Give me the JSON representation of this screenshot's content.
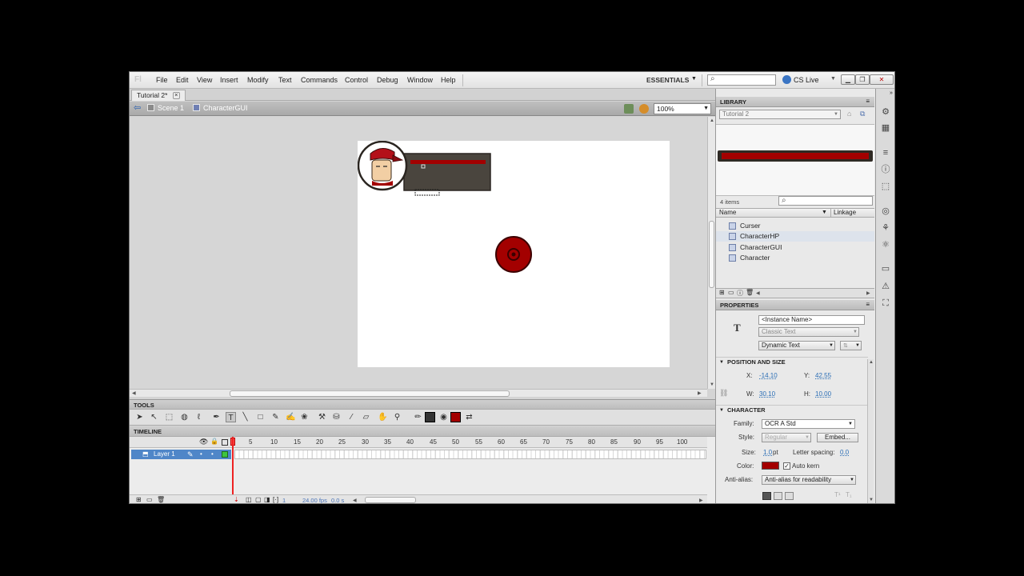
{
  "menu": [
    "File",
    "Edit",
    "View",
    "Insert",
    "Modify",
    "Text",
    "Commands",
    "Control",
    "Debug",
    "Window",
    "Help"
  ],
  "app_logo": "Fl",
  "workspace": "ESSENTIALS",
  "cs_live": "CS Live",
  "doc_tab": "Tutorial 2*",
  "breadcrumbs": [
    "Scene 1",
    "CharacterGUI"
  ],
  "zoom": "100%",
  "panels": {
    "tools": "TOOLS",
    "timeline": "TIMELINE",
    "library": "LIBRARY",
    "properties": "PROPERTIES"
  },
  "timeline": {
    "layer_name": "Layer 1",
    "frame_numbers": [
      "5",
      "10",
      "15",
      "20",
      "25",
      "30",
      "35",
      "40",
      "45",
      "50",
      "55",
      "60",
      "65",
      "70",
      "75",
      "80",
      "85",
      "90",
      "95",
      "100"
    ],
    "current_frame": "1",
    "fps": "24.00 fps",
    "time": "0.0 s"
  },
  "library": {
    "document": "Tutorial 2",
    "item_count": "4 items",
    "col_name": "Name",
    "col_linkage": "Linkage",
    "items": [
      "Curser",
      "CharacterHP",
      "CharacterGUI",
      "Character"
    ]
  },
  "properties": {
    "instance_name_placeholder": "<Instance Name>",
    "text_engine": "Classic Text",
    "text_type": "Dynamic Text",
    "section_position": "POSITION AND SIZE",
    "x_label": "X:",
    "x_value": "-14.10",
    "y_label": "Y:",
    "y_value": "42.55",
    "w_label": "W:",
    "w_value": "30.10",
    "h_label": "H:",
    "h_value": "10.00",
    "section_character": "CHARACTER",
    "family_label": "Family:",
    "family_value": "OCR A Std",
    "style_label": "Style:",
    "style_value": "Regular",
    "embed_label": "Embed...",
    "size_label": "Size:",
    "size_value": "1.0",
    "size_unit": "pt",
    "letter_spacing_label": "Letter spacing:",
    "letter_spacing_value": "0.0",
    "color_label": "Color:",
    "color_value": "#a30000",
    "auto_kern_label": "Auto kern",
    "antialias_label": "Anti-alias:",
    "antialias_value": "Anti-alias for readability"
  },
  "colors": {
    "accent_red": "#a30000",
    "layer_selection": "#4f86c8",
    "gui_panel": "#4a453e"
  }
}
